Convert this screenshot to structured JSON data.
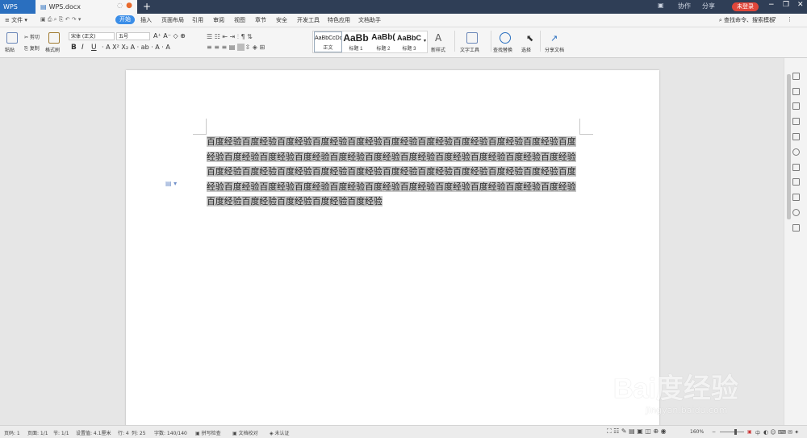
{
  "titlebar": {
    "app_tab": "WPS",
    "doc_tab": "WPS.docx",
    "add_tab": "+",
    "login_label": "未登录",
    "right_items": [
      "协作",
      "分享"
    ]
  },
  "menubar": {
    "file": "≡ 文件 ▾",
    "items": [
      "开始",
      "插入",
      "页面布局",
      "引用",
      "审阅",
      "视图",
      "章节",
      "安全",
      "开发工具",
      "特色应用",
      "文档助手"
    ],
    "search": "查找命令、搜索模板",
    "help": "?"
  },
  "ribbon": {
    "paste": "粘贴",
    "cut": "剪切",
    "copy": "复制",
    "format_painter": "格式刷",
    "font_name": "宋体 (正文)",
    "font_size": "五号",
    "bold": "B",
    "italic": "I",
    "underline": "U",
    "styles": [
      {
        "sample": "AaBbCcDd",
        "label": "正文"
      },
      {
        "sample": "AaBb",
        "label": "标题 1"
      },
      {
        "sample": "AaBb(",
        "label": "标题 2"
      },
      {
        "sample": "AaBbC",
        "label": "标题 3"
      }
    ],
    "new_style": "新样式",
    "text_tools": "文字工具",
    "find_replace": "查找替换",
    "select": "选择",
    "share_doc": "分享文档"
  },
  "document": {
    "text": "百度经验百度经验百度经验百度经验百度经验百度经验百度经验百度经验百度经验百度经验百度经验百度经验百度经验百度经验百度经验百度经验百度经验百度经验百度经验百度经验百度经验百度经验百度经验百度经验百度经验百度经验百度经验百度经验百度经验百度经验百度经验百度经验百度经验百度经验百度经验百度经验百度经验百度经验百度经验百度经验百度经验百度经验百度经验百度经验百度经验百度经验百度经验"
  },
  "statusbar": {
    "page": "页码: 1",
    "pages": "页面: 1/1",
    "section": "节: 1/1",
    "position": "设置值: 4.1厘米",
    "row": "行: 4",
    "col": "列: 25",
    "words": "字数: 140/140",
    "spell": "拼写检查",
    "compare": "文档校对",
    "cert": "未认证",
    "zoom": "160%",
    "ime": "中"
  },
  "watermark": {
    "brand": "Bai度经验",
    "url": "jingyan.baidu.com"
  }
}
